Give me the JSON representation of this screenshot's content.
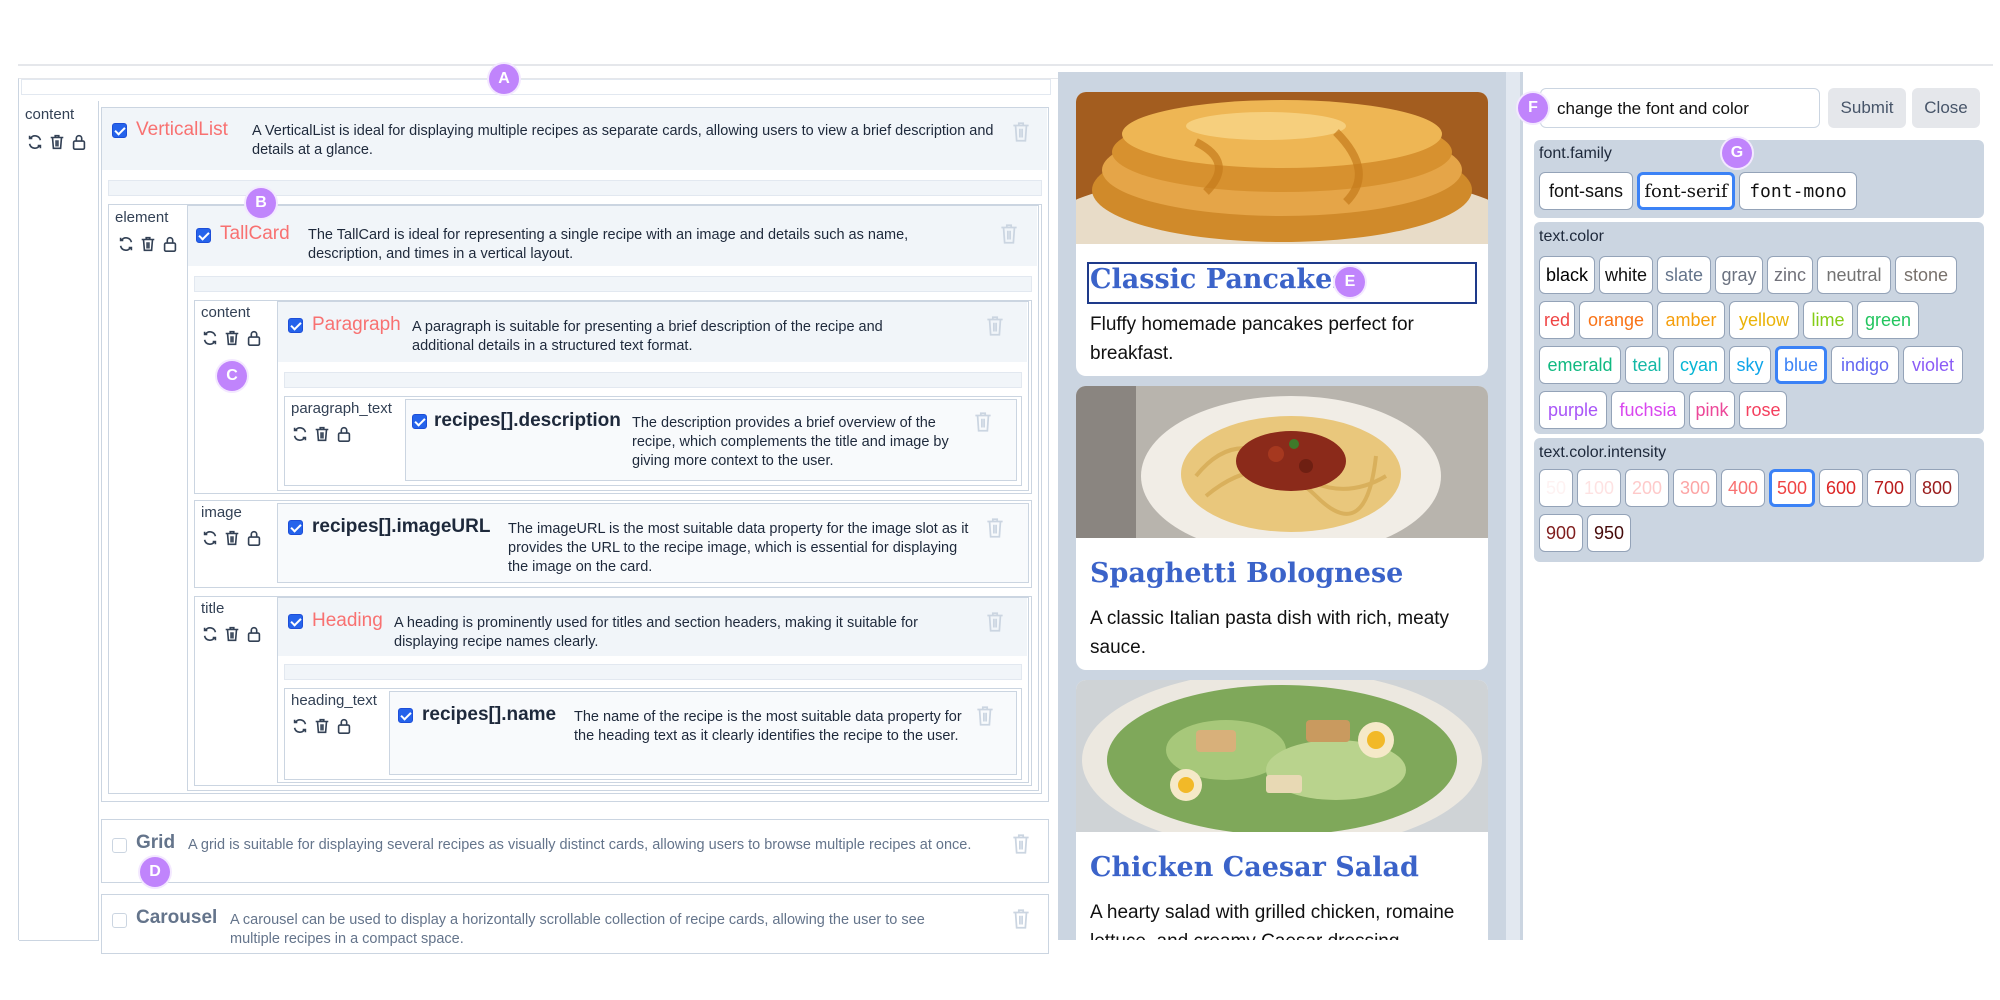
{
  "markers": {
    "a": "A",
    "b": "B",
    "c": "C",
    "d": "D",
    "e": "E",
    "f": "F",
    "g": "G"
  },
  "editor": {
    "root_slot_label": "content",
    "vertical_list": {
      "name": "VerticalList",
      "desc": "A VerticalList is ideal for displaying multiple recipes as separate cards, allowing users to view a brief description and details at a glance.",
      "checked": true
    },
    "element_slot_label": "element",
    "tall_card": {
      "name": "TallCard",
      "desc": "The TallCard is ideal for representing a single recipe with an image and details such as name, description, and times in a vertical layout.",
      "checked": true
    },
    "content_slot_label": "content",
    "paragraph": {
      "name": "Paragraph",
      "desc": "A paragraph is suitable for presenting a brief description of the recipe and additional details in a structured text format.",
      "checked": true
    },
    "paragraph_text_label": "paragraph_text",
    "desc_prop": {
      "name": "recipes[].description",
      "desc": "The description provides a brief overview of the recipe, which complements the title and image by giving more context to the user.",
      "checked": true
    },
    "image_slot_label": "image",
    "image_prop": {
      "name": "recipes[].imageURL",
      "desc": "The imageURL is the most suitable data property for the image slot as it provides the URL to the recipe image, which is essential for displaying the image on the card.",
      "checked": true
    },
    "title_slot_label": "title",
    "heading": {
      "name": "Heading",
      "desc": "A heading is prominently used for titles and section headers, making it suitable for displaying recipe names clearly.",
      "checked": true
    },
    "heading_text_label": "heading_text",
    "name_prop": {
      "name": "recipes[].name",
      "desc": "The name of the recipe is the most suitable data property for the heading text as it clearly identifies the recipe to the user.",
      "checked": true
    },
    "grid": {
      "name": "Grid",
      "desc": "A grid is suitable for displaying several recipes as visually distinct cards, allowing users to browse multiple recipes at once.",
      "checked": false
    },
    "carousel": {
      "name": "Carousel",
      "desc": "A carousel can be used to display a horizontally scrollable collection of recipe cards, allowing the user to see multiple recipes in a compact space.",
      "checked": false
    }
  },
  "preview": {
    "recipes": [
      {
        "title": "Classic Pancakes",
        "desc": "Fluffy homemade pancakes perfect for breakfast.",
        "image": "pancakes-photo"
      },
      {
        "title": "Spaghetti Bolognese",
        "desc": "A classic Italian pasta dish with rich, meaty sauce.",
        "image": "spaghetti-photo"
      },
      {
        "title": "Chicken Caesar Salad",
        "desc": "A hearty salad with grilled chicken, romaine lettuce, and creamy Caesar dressing.",
        "image": "salad-photo"
      }
    ],
    "title_color": "#3b63c9"
  },
  "panel": {
    "prompt_value": "change the font and color",
    "submit_label": "Submit",
    "close_label": "Close",
    "font_family": {
      "label": "font.family",
      "options": [
        "font-sans",
        "font-serif",
        "font-mono"
      ],
      "selected": "font-serif"
    },
    "text_color": {
      "label": "text.color",
      "options": [
        "black",
        "white",
        "slate",
        "gray",
        "zinc",
        "neutral",
        "stone",
        "red",
        "orange",
        "amber",
        "yellow",
        "lime",
        "green",
        "emerald",
        "teal",
        "cyan",
        "sky",
        "blue",
        "indigo",
        "violet",
        "purple",
        "fuchsia",
        "pink",
        "rose"
      ],
      "selected": "blue"
    },
    "intensity": {
      "label": "text.color.intensity",
      "options": [
        "50",
        "100",
        "200",
        "300",
        "400",
        "500",
        "600",
        "700",
        "800",
        "900",
        "950"
      ],
      "selected": "500"
    },
    "selection_color": "#3b82f6"
  }
}
